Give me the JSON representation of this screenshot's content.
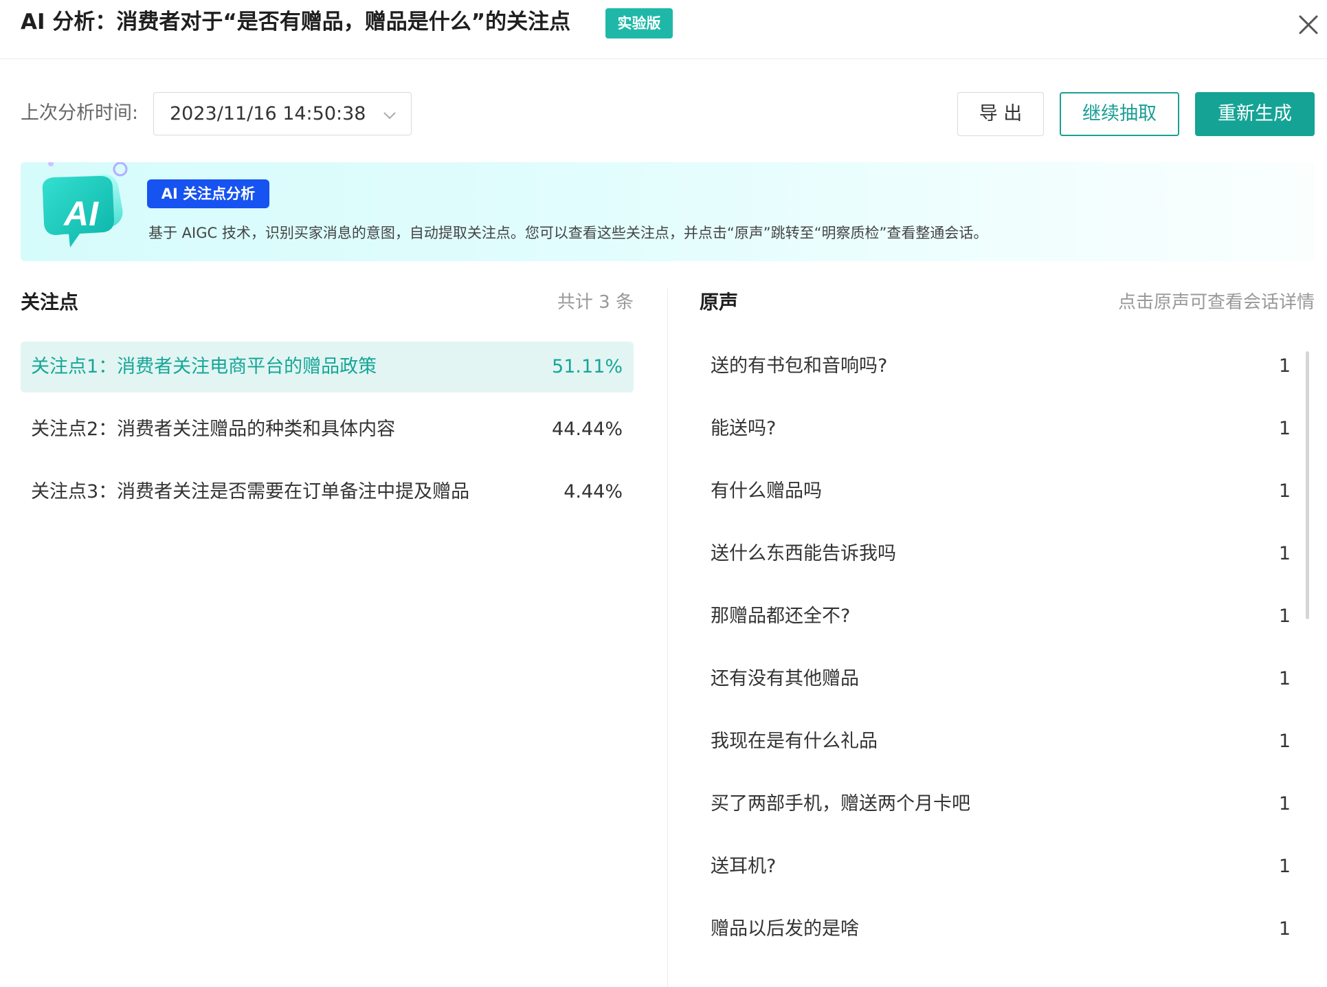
{
  "header": {
    "title": "AI 分析：消费者对于“是否有赠品，赠品是什么”的关注点",
    "badge": "实验版"
  },
  "toolbar": {
    "time_label": "上次分析时间:",
    "time_value": "2023/11/16 14:50:38",
    "export_label": "导 出",
    "continue_label": "继续抽取",
    "regenerate_label": "重新生成"
  },
  "banner": {
    "logo_text": "AI",
    "tag": "AI 关注点分析",
    "description": "基于 AIGC 技术，识别买家消息的意图，自动提取关注点。您可以查看这些关注点，并点击“原声”跳转至“明察质检”查看整通会话。"
  },
  "focus_panel": {
    "title": "关注点",
    "count_text": "共计 3 条",
    "items": [
      {
        "label": "关注点1：消费者关注电商平台的赠品政策",
        "percent": "51.11%",
        "active": true
      },
      {
        "label": "关注点2：消费者关注赠品的种类和具体内容",
        "percent": "44.44%",
        "active": false
      },
      {
        "label": "关注点3：消费者关注是否需要在订单备注中提及赠品",
        "percent": "4.44%",
        "active": false
      }
    ]
  },
  "voice_panel": {
    "title": "原声",
    "hint": "点击原声可查看会话详情",
    "items": [
      {
        "text": "送的有书包和音响吗?",
        "count": "1"
      },
      {
        "text": "能送吗?",
        "count": "1"
      },
      {
        "text": "有什么赠品吗",
        "count": "1"
      },
      {
        "text": "送什么东西能告诉我吗",
        "count": "1"
      },
      {
        "text": "那赠品都还全不?",
        "count": "1"
      },
      {
        "text": "还有没有其他赠品",
        "count": "1"
      },
      {
        "text": "我现在是有什么礼品",
        "count": "1"
      },
      {
        "text": "买了两部手机，赠送两个月卡吧",
        "count": "1"
      },
      {
        "text": "送耳机?",
        "count": "1"
      },
      {
        "text": "赠品以后发的是啥",
        "count": "1"
      }
    ]
  },
  "colors": {
    "accent": "#16a697",
    "badge_bg": "#1fb8a8",
    "tag_bg": "#1653f0",
    "active_row_bg": "#e2f5f3"
  },
  "icons": {
    "close": "close-icon",
    "dropdown": "chevron-down-icon",
    "logo": "ai-chat-bubble-logo"
  }
}
